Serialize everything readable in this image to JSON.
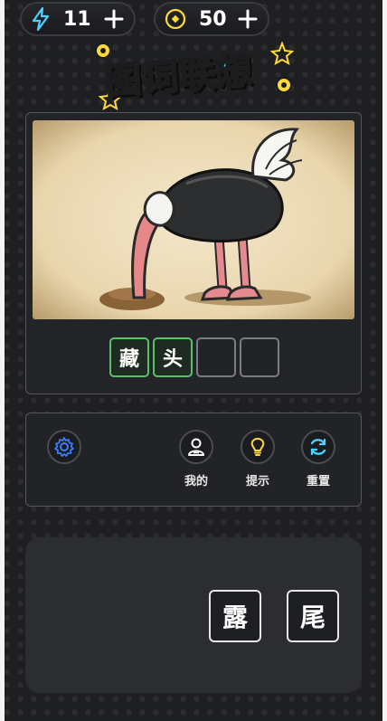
{
  "header": {
    "energy": "11",
    "coins": "50",
    "title_part1": "图词",
    "title_part2": "联想"
  },
  "puzzle": {
    "image_icon": "ostrich-head-in-sand",
    "slots": [
      "藏",
      "头",
      "",
      ""
    ]
  },
  "tools": {
    "settings_icon": "gear-icon",
    "mine_label": "我的",
    "hint_label": "提示",
    "reset_label": "重置"
  },
  "choices": [
    "露",
    "尾"
  ],
  "colors": {
    "title_yellow": "#ffd93a",
    "title_blue": "#4fd0ff",
    "slot_correct": "#57c26a",
    "background": "#1e1f21"
  }
}
